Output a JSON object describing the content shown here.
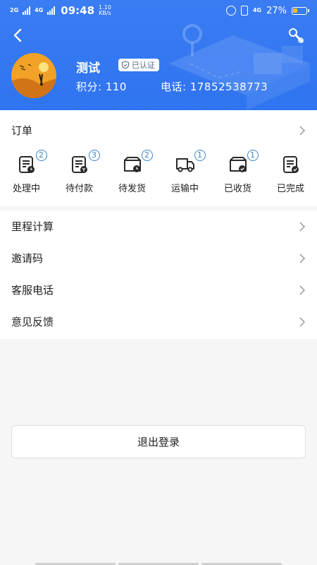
{
  "statusbar": {
    "net1": "2G",
    "net2": "4G",
    "time": "09:48",
    "speed_value": "1.10",
    "speed_unit": "KB/s",
    "net3": "4G",
    "battery": "27%"
  },
  "profile": {
    "name": "测试",
    "verified_label": "已认证",
    "points_label": "积分:",
    "points_value": "110",
    "phone_label": "电话:",
    "phone_value": "17852538773"
  },
  "orders": {
    "title": "订单",
    "statuses": [
      {
        "label": "处理中",
        "count": "2",
        "icon": "order-processing-icon"
      },
      {
        "label": "待付款",
        "count": "3",
        "icon": "pending-payment-icon"
      },
      {
        "label": "待发货",
        "count": "2",
        "icon": "pending-shipment-icon"
      },
      {
        "label": "运输中",
        "count": "1",
        "icon": "truck-icon"
      },
      {
        "label": "已收货",
        "count": "1",
        "icon": "received-box-icon"
      },
      {
        "label": "已完成",
        "count": "",
        "icon": "completed-icon"
      }
    ]
  },
  "menu": {
    "items": [
      {
        "label": "里程计算"
      },
      {
        "label": "邀请码"
      },
      {
        "label": "客服电话"
      },
      {
        "label": "意见反馈"
      }
    ]
  },
  "logout_label": "退出登录",
  "colors": {
    "header": "#3a7cf2",
    "badge_blue": "#3a86c9",
    "icon_dark": "#2a2a2a"
  }
}
